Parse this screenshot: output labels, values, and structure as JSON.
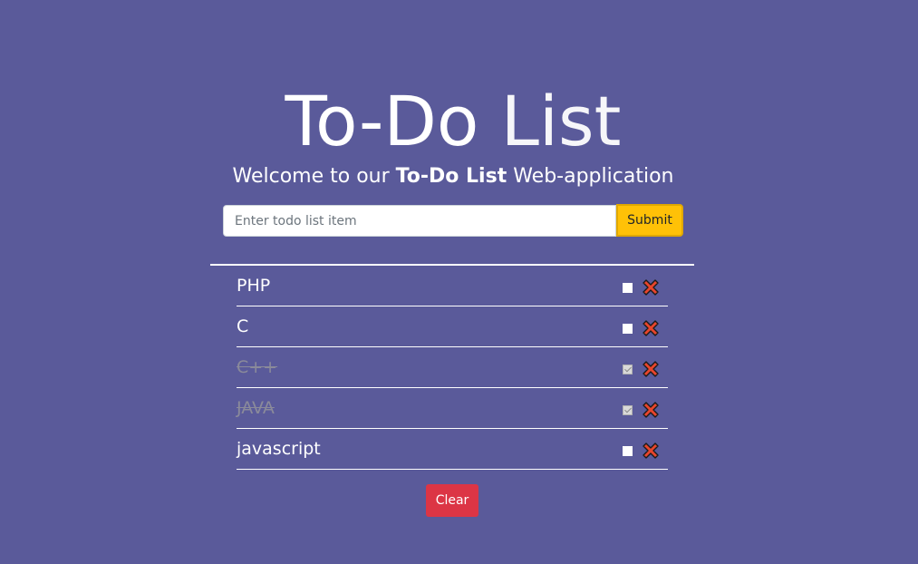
{
  "header": {
    "title_part1": "To-Do",
    "title_part2": "List",
    "subtitle_prefix": "Welcome to our ",
    "subtitle_bold": "To-Do List",
    "subtitle_suffix": " Web-application"
  },
  "form": {
    "input_value": "",
    "input_placeholder": "Enter todo list item",
    "submit_label": "Submit"
  },
  "todos": [
    {
      "text": "PHP",
      "done": false
    },
    {
      "text": "C",
      "done": false
    },
    {
      "text": "C++",
      "done": true
    },
    {
      "text": "JAVA",
      "done": true
    },
    {
      "text": "javascript",
      "done": false
    }
  ],
  "clear_label": "Clear",
  "icons": {
    "delete": "close-x-icon",
    "check": "checkbox-icon"
  },
  "colors": {
    "background": "#5a5a9a",
    "submit": "#ffc107",
    "clear": "#dc3545",
    "delete_fill": "#e8452c"
  }
}
